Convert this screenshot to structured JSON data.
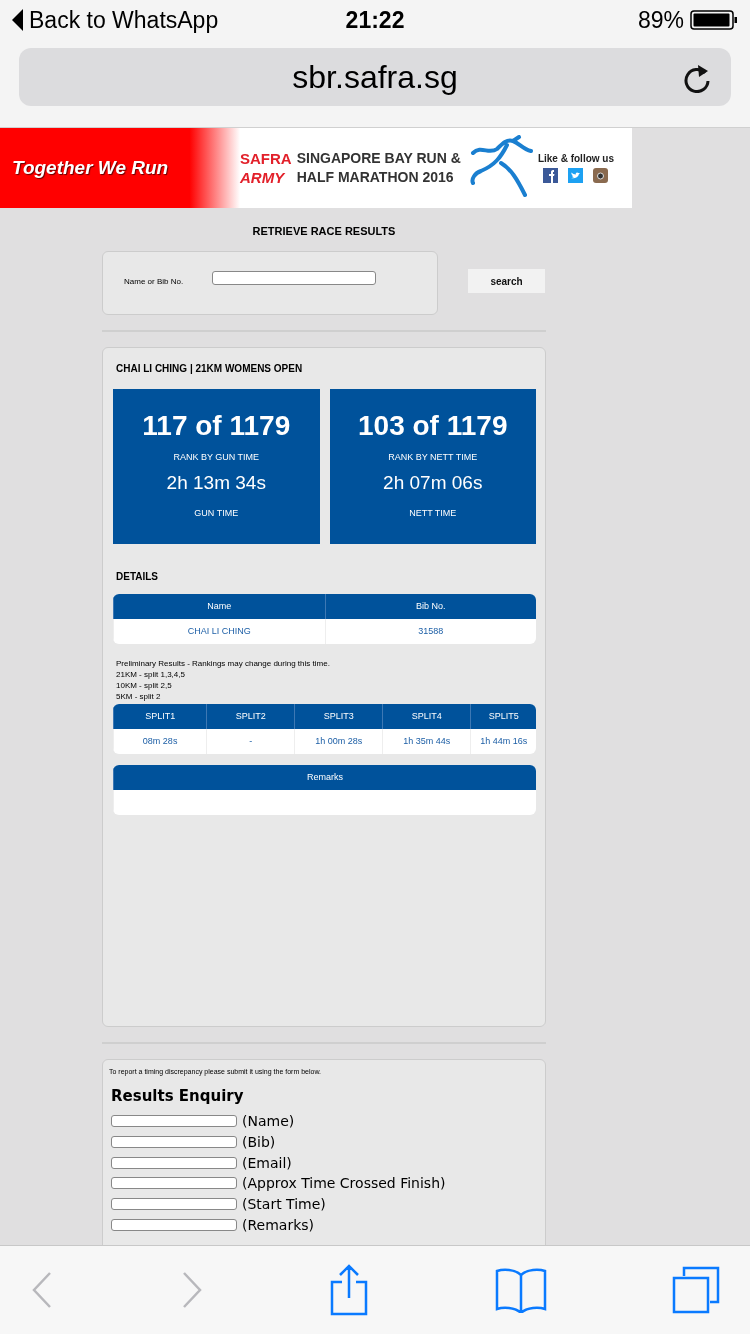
{
  "status_bar": {
    "back_label": "Back to WhatsApp",
    "time": "21:22",
    "battery": "89%"
  },
  "address_bar": {
    "url": "sbr.safra.sg"
  },
  "banner": {
    "slogan": "Together We Run",
    "brand_top": "SAFRA",
    "brand_bottom": "ARMY",
    "event_line_1": "SINGAPORE BAY RUN &",
    "event_line_2": "HALF MARATHON 2016",
    "social_label": "Like & follow us"
  },
  "page_title": "RETRIEVE RACE RESULTS",
  "search": {
    "label": "Name or Bib No.",
    "button": "search"
  },
  "result": {
    "heading": "CHAI LI CHING | 21KM WOMENS OPEN",
    "stats": [
      {
        "rank": "117 of 1179",
        "rank_label": "RANK BY GUN TIME",
        "time": "2h 13m 34s",
        "time_label": "GUN TIME"
      },
      {
        "rank": "103 of 1179",
        "rank_label": "RANK BY NETT TIME",
        "time": "2h 07m 06s",
        "time_label": "NETT TIME"
      }
    ],
    "details_heading": "DETAILS",
    "details_table": {
      "columns": [
        "Name",
        "Bib No."
      ],
      "rows": [
        [
          "CHAI LI CHING",
          "31588"
        ]
      ]
    },
    "notes": [
      "Preliminary Results - Rankings may change during this time.",
      "21KM - split 1,3,4,5",
      "10KM - split 2,5",
      "5KM - split 2"
    ],
    "splits_table": {
      "columns": [
        "SPLIT1",
        "SPLIT2",
        "SPLIT3",
        "SPLIT4",
        "SPLIT5"
      ],
      "rows": [
        [
          "08m 28s",
          "-",
          "1h 00m 28s",
          "1h 35m 44s",
          "1h 44m 16s"
        ]
      ]
    },
    "remarks_table": {
      "columns": [
        "Remarks"
      ]
    }
  },
  "enquiry": {
    "intro": "To report a timing discrepancy please submit it using the form below.",
    "title": "Results Enquiry",
    "fields": [
      {
        "label": "(Name)"
      },
      {
        "label": "(Bib)"
      },
      {
        "label": "(Email)"
      },
      {
        "label": "(Approx Time Crossed Finish)"
      },
      {
        "label": "(Start Time)"
      },
      {
        "label": "(Remarks)"
      }
    ]
  },
  "toolbar": {
    "buttons": [
      {
        "kind": "back",
        "disabled": true
      },
      {
        "kind": "forward",
        "disabled": true
      },
      {
        "kind": "share",
        "disabled": false
      },
      {
        "kind": "bookmarks",
        "disabled": false
      },
      {
        "kind": "tabs",
        "disabled": false
      }
    ]
  }
}
